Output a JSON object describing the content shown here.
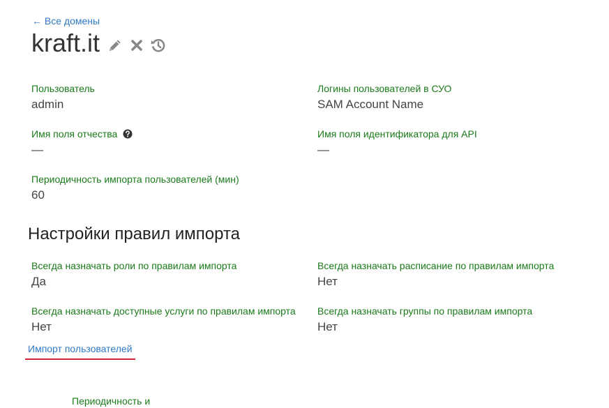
{
  "back_link": "← Все домены",
  "domain_title": "kraft.it",
  "icons": {
    "edit": "pencil-icon",
    "delete": "close-icon",
    "history": "history-icon",
    "help": "question-circle-icon"
  },
  "fields": {
    "user": {
      "label": "Пользователь",
      "value": "admin"
    },
    "logins": {
      "label": "Логины пользователей в СУО",
      "value": "SAM Account Name"
    },
    "patronymic": {
      "label": "Имя поля отчества",
      "value": "—"
    },
    "api_id": {
      "label": "Имя поля идентификатора для API",
      "value": "—"
    },
    "period": {
      "label": "Периодичность импорта пользователей (мин)",
      "value": "60"
    }
  },
  "import_rules": {
    "title": "Настройки правил импорта",
    "roles": {
      "label": "Всегда назначать роли по правилам импорта",
      "value": "Да"
    },
    "schedule": {
      "label": "Всегда назначать расписание по правилам импорта",
      "value": "Нет"
    },
    "services": {
      "label": "Всегда назначать доступные услуги по правилам импорта",
      "value": "Нет"
    },
    "groups": {
      "label": "Всегда назначать группы по правилам импорта",
      "value": "Нет"
    }
  },
  "tab_import_users": "Импорт пользователей",
  "bottom_partial_label": "Периодичность и",
  "colors": {
    "link": "#2f78c4",
    "label_green": "#1a7a1a",
    "tab_underline": "#d0243a",
    "icon_gray": "#888888"
  }
}
